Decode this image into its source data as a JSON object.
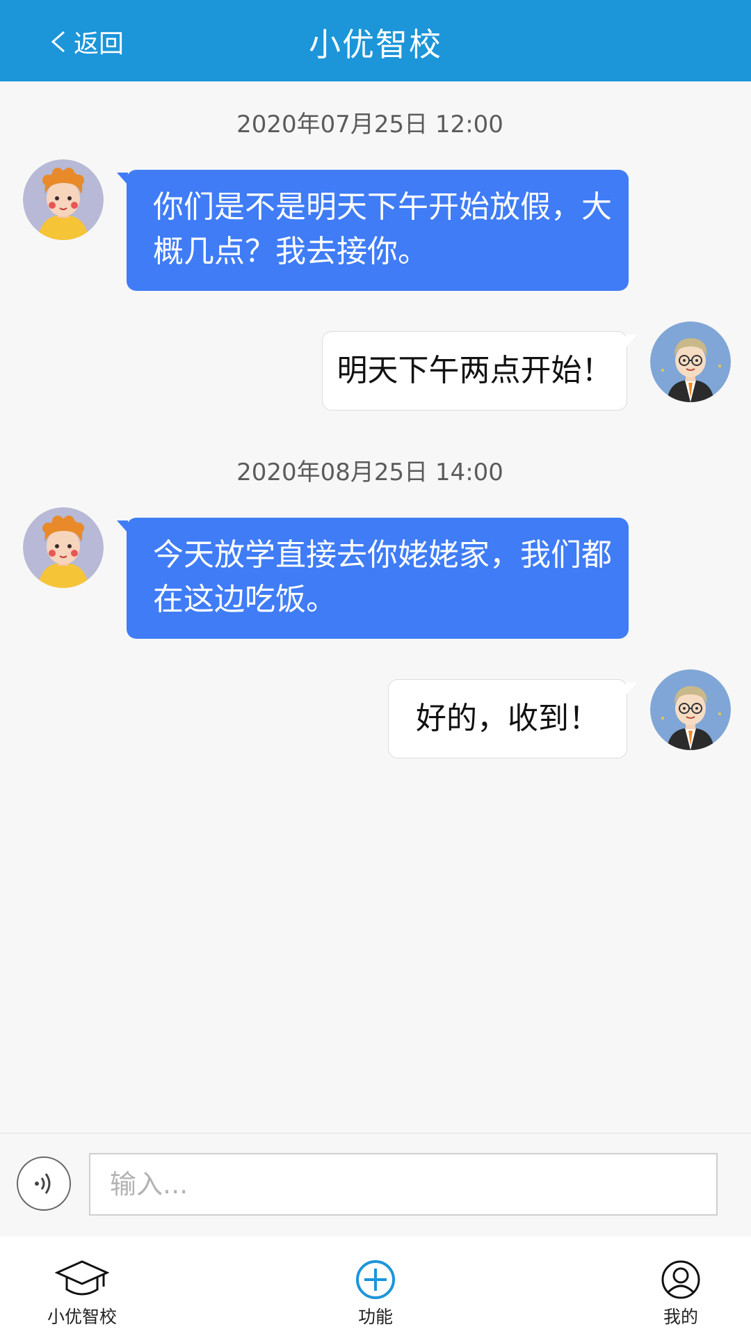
{
  "header": {
    "back_label": "返回",
    "title": "小优智校"
  },
  "messages": [
    {
      "kind": "time",
      "text": "2020年07月25日 12:00"
    },
    {
      "kind": "incoming",
      "text": "你们是不是明天下午开始放假，大概几点？我去接你。"
    },
    {
      "kind": "outgoing",
      "text": "明天下午两点开始！"
    },
    {
      "kind": "time",
      "text": "2020年08月25日 14:00"
    },
    {
      "kind": "incoming",
      "text": "今天放学直接去你姥姥家，我们都在这边吃饭。"
    },
    {
      "kind": "outgoing",
      "text": "好的，收到！"
    }
  ],
  "input": {
    "placeholder": "输入..."
  },
  "tabs": [
    {
      "label": "小优智校",
      "icon": "graduation-cap-icon"
    },
    {
      "label": "功能",
      "icon": "plus-circle-icon"
    },
    {
      "label": "我的",
      "icon": "user-icon"
    }
  ],
  "colors": {
    "header": "#1c95d9",
    "incoming_bubble": "#3f7cf6",
    "outgoing_bubble": "#ffffff",
    "accent_icon": "#1c95d9"
  }
}
